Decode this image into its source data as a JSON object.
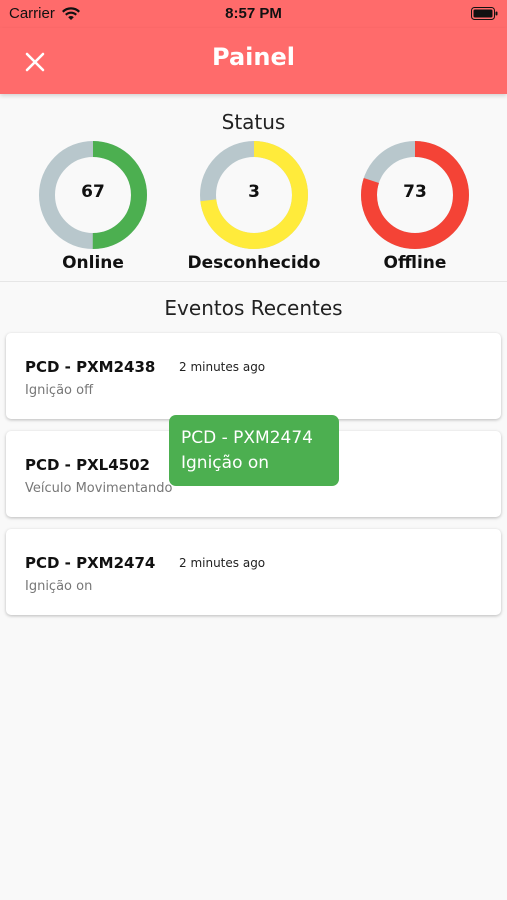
{
  "status_bar": {
    "carrier": "Carrier",
    "time": "8:57 PM"
  },
  "header": {
    "title": "Painel"
  },
  "status": {
    "title": "Status",
    "gauges": [
      {
        "label": "Online",
        "count": "67",
        "fraction": 0.5,
        "color": "#4caf50",
        "track_color": "#b8c7cc"
      },
      {
        "label": "Desconhecido",
        "count": "3",
        "fraction": 0.73,
        "color": "#ffeb3b",
        "track_color": "#b8c7cc"
      },
      {
        "label": "Offline",
        "count": "73",
        "fraction": 0.8,
        "color": "#f44336",
        "track_color": "#b8c7cc"
      }
    ]
  },
  "events": {
    "title": "Eventos Recentes",
    "items": [
      {
        "vehicle": "PCD - PXM2438",
        "time": "2 minutes ago",
        "description": "Ignição off"
      },
      {
        "vehicle": "PCD - PXL4502",
        "time": "",
        "description": "Veículo Movimentando"
      },
      {
        "vehicle": "PCD - PXM2474",
        "time": "2 minutes ago",
        "description": "Ignição on"
      }
    ]
  },
  "toast": {
    "line1": "PCD - PXM2474",
    "line2": "Ignição on",
    "color": "#4caf50"
  },
  "colors": {
    "header": "#ff6b6b",
    "background": "#f9f9f9"
  }
}
